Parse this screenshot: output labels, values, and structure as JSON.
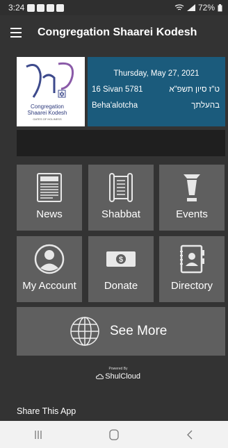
{
  "status_bar": {
    "time": "3:24",
    "battery": "72%"
  },
  "app_bar": {
    "title": "Congregation Shaarei Kodesh"
  },
  "logo": {
    "text": "Congregation Shaarei Kodesh",
    "sub": "GATES OF HOLINESS"
  },
  "date_card": {
    "gregorian": "Thursday, May 27, 2021",
    "hebrew_date_en": "16 Sivan 5781",
    "hebrew_date_he": "ט\"ז סיון תשפ\"א",
    "parsha_en": "Beha'alotcha",
    "parsha_he": "בהעלתך"
  },
  "tiles": [
    {
      "label": "News",
      "icon": "newspaper-icon"
    },
    {
      "label": "Shabbat",
      "icon": "torah-scroll-icon"
    },
    {
      "label": "Events",
      "icon": "drink-icon"
    },
    {
      "label": "My Account",
      "icon": "user-avatar-icon"
    },
    {
      "label": "Donate",
      "icon": "dollar-bill-icon"
    },
    {
      "label": "Directory",
      "icon": "address-book-icon"
    }
  ],
  "see_more": {
    "label": "See More",
    "icon": "globe-icon"
  },
  "powered": {
    "by": "Powered By",
    "brand": "ShulCloud"
  },
  "share": {
    "label": "Share This App"
  },
  "nav": {
    "recents": "recents-icon",
    "home": "home-icon",
    "back": "back-icon"
  }
}
